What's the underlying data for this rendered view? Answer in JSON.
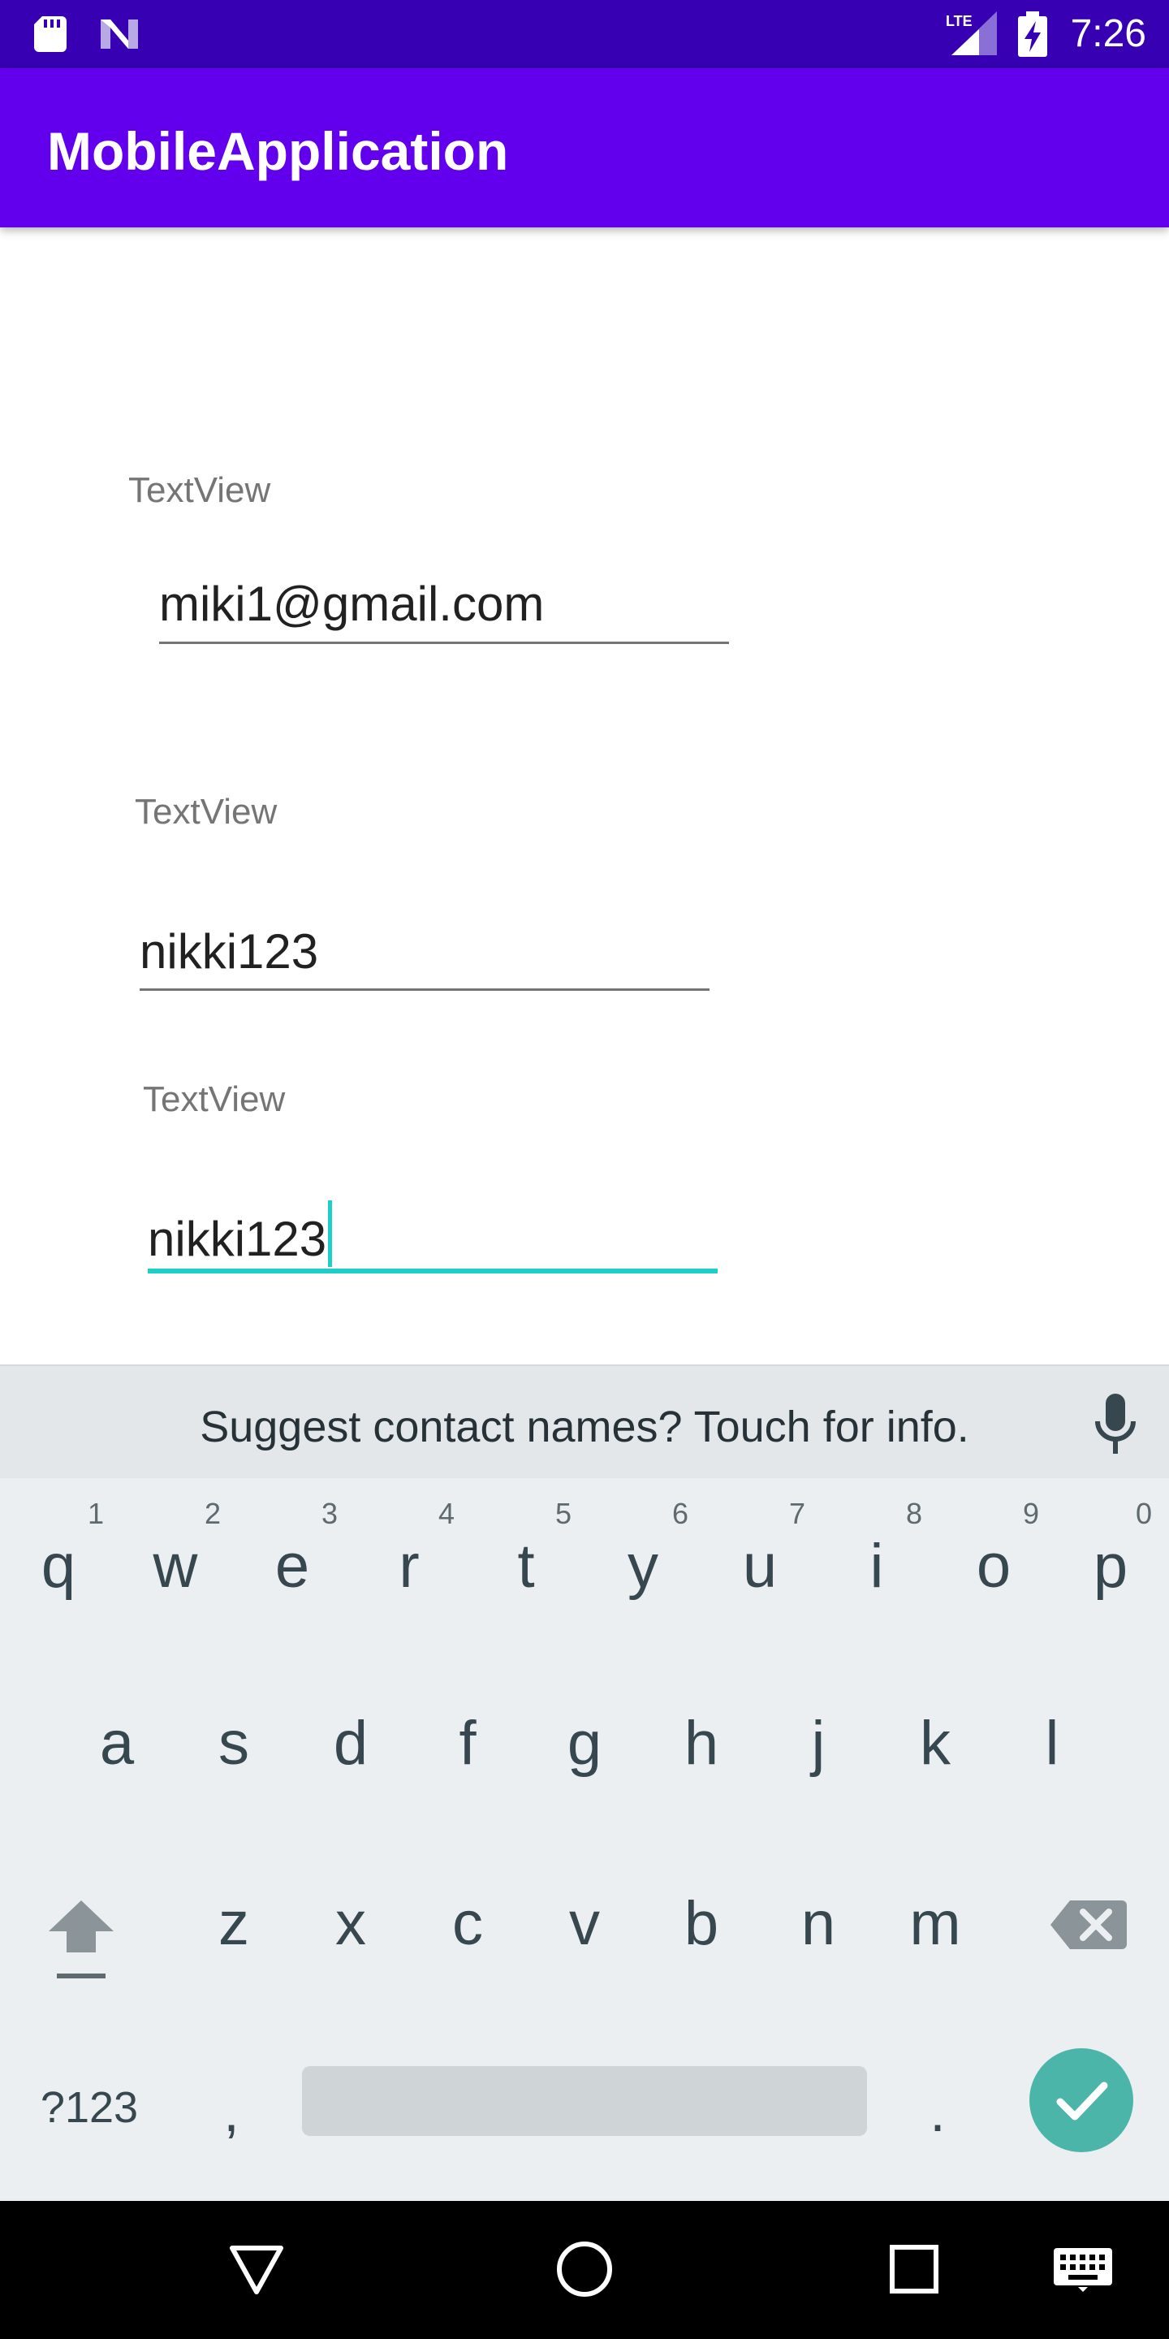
{
  "status_bar": {
    "time": "7:26",
    "network": "LTE",
    "icons": [
      "sdcard-icon",
      "n-logo-icon",
      "signal-icon",
      "battery-charging-icon"
    ]
  },
  "app_bar": {
    "title": "MobileApplication",
    "color": "#6200ee",
    "status_color": "#3700b3"
  },
  "form": {
    "fields": [
      {
        "label": "TextView",
        "value": "miki1@gmail.com",
        "focused": false
      },
      {
        "label": "TextView",
        "value": "nikki123",
        "focused": false
      },
      {
        "label": "TextView",
        "value": "nikki123",
        "focused": true
      }
    ],
    "focus_color": "#1ccfc8"
  },
  "keyboard": {
    "suggestion": "Suggest contact names? Touch for info.",
    "row1": [
      "q",
      "w",
      "e",
      "r",
      "t",
      "y",
      "u",
      "i",
      "o",
      "p"
    ],
    "row1_hints": [
      "1",
      "2",
      "3",
      "4",
      "5",
      "6",
      "7",
      "8",
      "9",
      "0"
    ],
    "row2": [
      "a",
      "s",
      "d",
      "f",
      "g",
      "h",
      "j",
      "k",
      "l"
    ],
    "row3": [
      "z",
      "x",
      "c",
      "v",
      "b",
      "n",
      "m"
    ],
    "symbols_label": "?123",
    "comma": ",",
    "period": ".",
    "enter_color": "#4cb5a9"
  },
  "nav_bar": {
    "icons": [
      "back-icon",
      "home-icon",
      "recents-icon",
      "keyboard-switch-icon"
    ]
  }
}
